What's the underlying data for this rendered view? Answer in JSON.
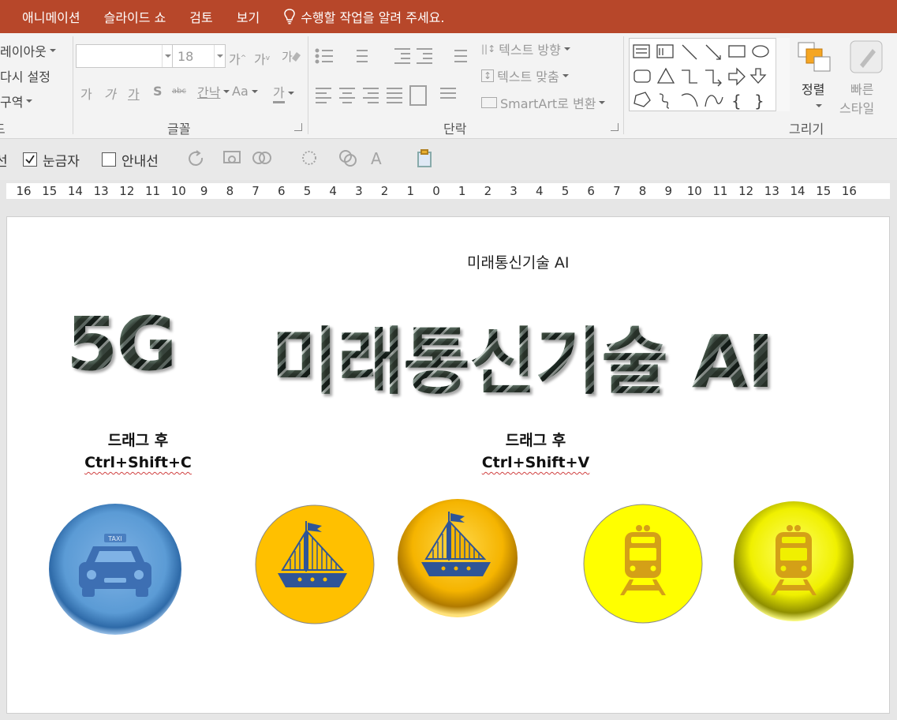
{
  "menu": {
    "tabs": [
      "애니메이션",
      "슬라이드 쇼",
      "검토",
      "보기"
    ],
    "tell_me": "수행할 작업을 알려 주세요."
  },
  "ribbon": {
    "slides_group": {
      "layout": "레이아웃",
      "reset": "다시 설정",
      "section": "구역",
      "label": "드"
    },
    "font_group": {
      "font_size": "18",
      "grow": "가",
      "shrink": "가",
      "bold": "가",
      "italic": "가",
      "underline": "가",
      "shadow": "S",
      "strike": "abc",
      "spacing": "간낙",
      "case": "Aa",
      "color": "가",
      "label": "글꼴"
    },
    "paragraph_group": {
      "text_direction": "텍스트 방향",
      "align_text": "텍스트 맞춤",
      "smartart": "SmartArt로 변환",
      "label": "단락"
    },
    "drawing_group": {
      "arrange": "정렬",
      "quick_styles_1": "빠른",
      "quick_styles_2": "스타일",
      "label": "그리기"
    }
  },
  "quickbar": {
    "cut_label": "선",
    "ruler": "눈금자",
    "guides": "안내선",
    "ruler_checked": true,
    "guides_checked": false
  },
  "ruler": {
    "ticks": [
      "16",
      "15",
      "14",
      "13",
      "12",
      "11",
      "10",
      "9",
      "8",
      "7",
      "6",
      "5",
      "4",
      "3",
      "2",
      "1",
      "0",
      "1",
      "2",
      "3",
      "4",
      "5",
      "6",
      "7",
      "8",
      "9",
      "10",
      "11",
      "12",
      "13",
      "14",
      "15",
      "16"
    ]
  },
  "slide": {
    "subtitle": "미래통신기술 AI",
    "title_5g": "5G",
    "title_main": "미래통신기술 AI",
    "hint1_line1": "드래그 후",
    "hint1_line2": "Ctrl+Shift+C",
    "hint2_line1": "드래그 후",
    "hint2_line2": "Ctrl+Shift+V",
    "taxi_sign": "TAXI"
  },
  "colors": {
    "tab_bar": "#b7472a",
    "taxi_circle": "#5b9bd5",
    "boat_circle": "#ffc000",
    "train_circle": "#ffff00",
    "icon_blue": "#2f5597",
    "icon_gold": "#d4a017"
  }
}
